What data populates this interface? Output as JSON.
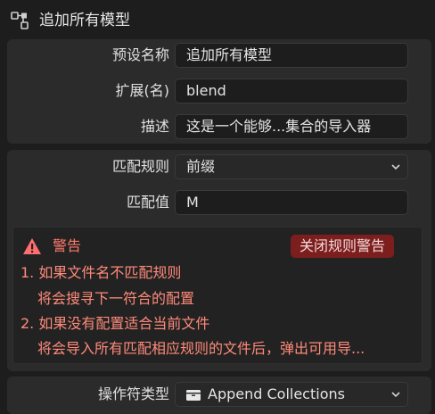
{
  "header": {
    "title": "追加所有模型",
    "icon": "nodes-icon"
  },
  "preset": {
    "name_label": "预设名称",
    "name_value": "追加所有模型",
    "ext_label": "扩展(名)",
    "ext_value": "blend",
    "desc_label": "描述",
    "desc_value": "这是一个能够...集合的导入器"
  },
  "match": {
    "rule_label": "匹配规则",
    "rule_value": "前缀",
    "value_label": "匹配值",
    "value_value": "M"
  },
  "warning": {
    "title": "警告",
    "close_label": "关闭规则警告",
    "line1": "1. 如果文件名不匹配规则",
    "line2": "将会搜寻下一符合的配置",
    "line3": "2. 如果没有配置适合当前文件",
    "line4": "将会导入所有匹配相应规则的文件后，弹出可用导..."
  },
  "operator": {
    "label": "操作符类型",
    "value": "Append Collections",
    "icon": "collection-icon"
  },
  "colors": {
    "warning_text": "#ff8a7a",
    "close_button": "#7d1e1e"
  }
}
